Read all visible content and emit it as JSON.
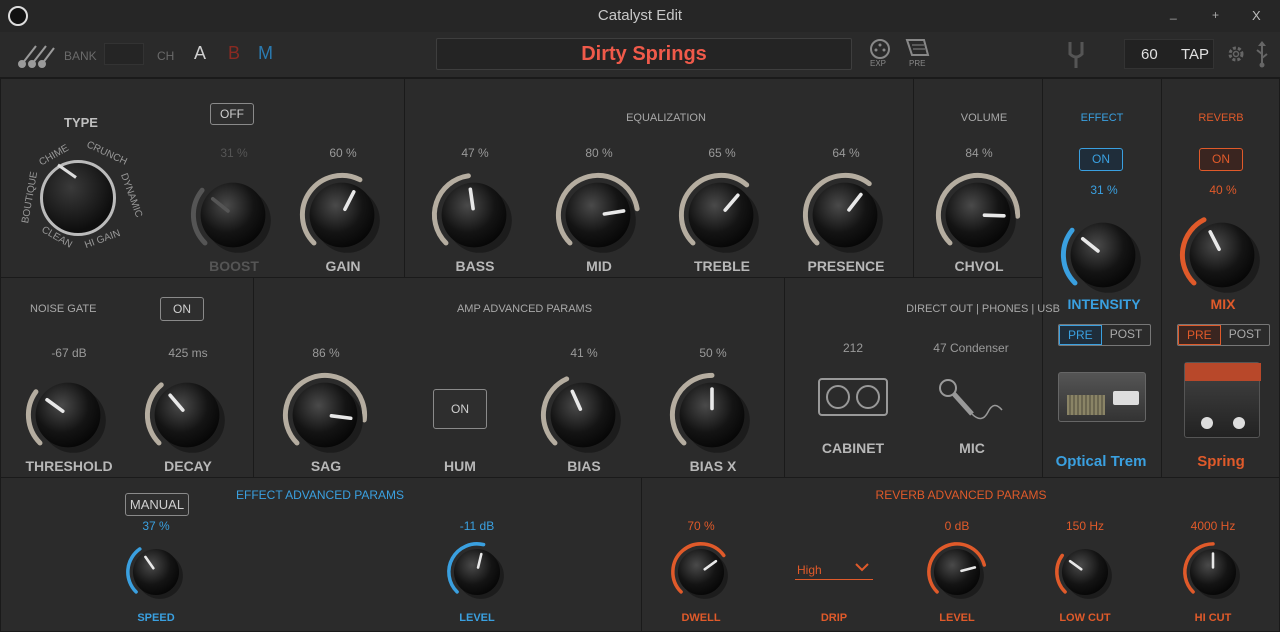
{
  "window": {
    "title": "Catalyst Edit",
    "minimize": "_",
    "maximize": "+",
    "close": "X"
  },
  "toolbar": {
    "bank_label": "BANK",
    "ch_label": "CH",
    "ch_a": "A",
    "ch_b": "B",
    "ch_m": "M",
    "preset_name": "Dirty Springs",
    "exp_label": "EXP",
    "pre_label": "PRE",
    "tempo": "60",
    "tap_label": "TAP"
  },
  "colors": {
    "accent_blue": "#3aa0e0",
    "accent_red": "#e05a2a",
    "preset_red": "#f05a4a"
  },
  "amp": {
    "type_title": "TYPE",
    "types": [
      "BOUTIQUE",
      "CHIME",
      "CRUNCH",
      "DYNAMIC",
      "HI GAIN",
      "CLEAN"
    ],
    "boost_btn": "OFF",
    "boost": {
      "value": "31 %",
      "label": "BOOST",
      "level": 0.31
    },
    "gain": {
      "value": "60 %",
      "label": "GAIN",
      "level": 0.6
    }
  },
  "eq": {
    "title": "EQUALIZATION",
    "bass": {
      "value": "47 %",
      "label": "BASS",
      "level": 0.47
    },
    "mid": {
      "value": "80 %",
      "label": "MID",
      "level": 0.8
    },
    "treble": {
      "value": "65 %",
      "label": "TREBLE",
      "level": 0.65
    },
    "presence": {
      "value": "64 %",
      "label": "PRESENCE",
      "level": 0.64
    }
  },
  "volume": {
    "title": "VOLUME",
    "value": "84 %",
    "label": "CHVOL",
    "level": 0.84
  },
  "effect": {
    "title": "EFFECT",
    "on_btn": "ON",
    "value": "31 %",
    "label": "INTENSITY",
    "level": 0.31,
    "pre": "PRE",
    "post": "POST",
    "name": "Optical Trem"
  },
  "reverb": {
    "title": "REVERB",
    "on_btn": "ON",
    "value": "40 %",
    "label": "MIX",
    "level": 0.4,
    "pre": "PRE",
    "post": "POST",
    "name": "Spring"
  },
  "noise_gate": {
    "title": "NOISE GATE",
    "btn": "ON",
    "threshold": {
      "value": "-67 dB",
      "label": "THRESHOLD",
      "level": 0.3
    },
    "decay": {
      "value": "425 ms",
      "label": "DECAY",
      "level": 0.35
    }
  },
  "amp_adv": {
    "title": "AMP ADVANCED PARAMS",
    "sag": {
      "value": "86 %",
      "label": "SAG",
      "level": 0.86
    },
    "hum": {
      "btn": "ON",
      "label": "HUM"
    },
    "bias": {
      "value": "41 %",
      "label": "BIAS",
      "level": 0.41
    },
    "bias_x": {
      "value": "50 %",
      "label": "BIAS X",
      "level": 0.5
    }
  },
  "direct_out": {
    "title": "DIRECT OUT | PHONES | USB",
    "cabinet_value": "212",
    "cabinet_label": "CABINET",
    "mic_value": "47 Condenser",
    "mic_label": "MIC"
  },
  "effect_adv": {
    "title": "EFFECT ADVANCED PARAMS",
    "manual_btn": "MANUAL",
    "speed": {
      "value": "37 %",
      "label": "SPEED",
      "level": 0.37
    },
    "level": {
      "value": "-11 dB",
      "label": "LEVEL",
      "level": 0.55
    }
  },
  "reverb_adv": {
    "title": "REVERB ADVANCED PARAMS",
    "dwell": {
      "value": "70 %",
      "label": "DWELL",
      "level": 0.7
    },
    "drip": {
      "selected": "High",
      "label": "DRIP"
    },
    "level": {
      "value": "0 dB",
      "label": "LEVEL",
      "level": 0.78
    },
    "low_cut": {
      "value": "150 Hz",
      "label": "LOW CUT",
      "level": 0.3
    },
    "hi_cut": {
      "value": "4000 Hz",
      "label": "HI CUT",
      "level": 0.5
    }
  }
}
